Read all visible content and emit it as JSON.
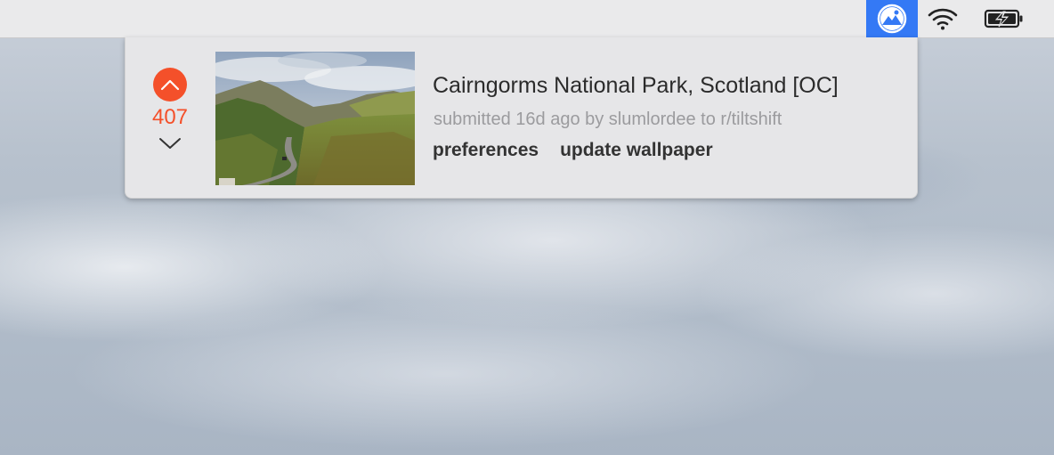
{
  "menubar": {
    "icons": [
      "reddit-wallpaper-app-icon",
      "wifi-icon",
      "battery-charging-icon"
    ],
    "active_color": "#3479f5"
  },
  "post": {
    "score": "407",
    "title": "Cairngorms National Park, Scotland [OC]",
    "meta": "submitted 16d ago by slumlordee to r/tiltshift",
    "upvote_icon": "chevron-up-icon",
    "downvote_icon": "chevron-down-icon",
    "accent_color": "#f4502a"
  },
  "actions": {
    "preferences_label": "preferences",
    "update_label": "update wallpaper"
  }
}
